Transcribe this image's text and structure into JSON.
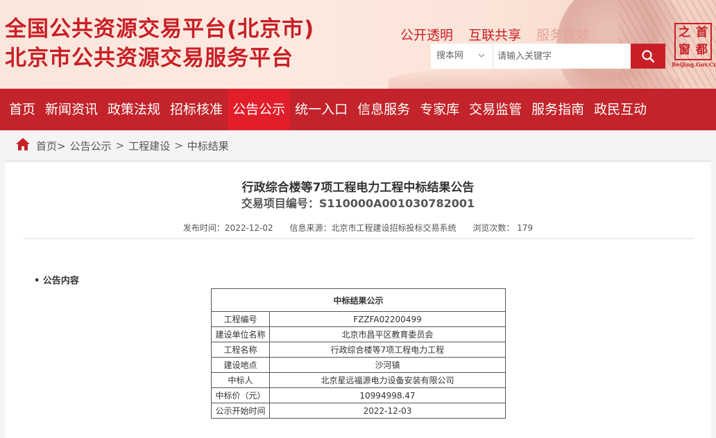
{
  "header": {
    "title_line1": "全国公共资源交易平台(北京市)",
    "title_line2": "北京市公共资源交易服务平台",
    "slogans": [
      "公开透明",
      "互联共享",
      "服务高效"
    ],
    "search": {
      "scope_selected": "搜本网",
      "placeholder": "请输入关键字",
      "button_icon": "search-icon"
    },
    "logo": {
      "chars": [
        "首",
        "都",
        "之",
        "窗"
      ],
      "caption": "Beijing.Gov.Cn"
    },
    "colors": {
      "brand_red": "#c81f26",
      "nav_bg": "#c3232a",
      "nav_active": "#e21e2a"
    }
  },
  "nav": {
    "items": [
      "首页",
      "新闻资讯",
      "政策法规",
      "招标核准",
      "公告公示",
      "统一入口",
      "信息服务",
      "专家库",
      "交易监管",
      "服务指南",
      "政民互动"
    ],
    "active": "公告公示"
  },
  "breadcrumb": {
    "home_icon": "home-icon",
    "home": "首页>",
    "items": [
      "公告公示",
      "工程建设",
      "中标结果"
    ],
    "separator": ">"
  },
  "article": {
    "title": "行政综合楼等7项工程电力工程中标结果公告",
    "code": "交易项目编号：S110000A001030782001",
    "publish_time": "发布时间：2022-12-02",
    "source": "信息来源：北京市工程建设招标投标交易系统",
    "views": "浏览次数：  179",
    "section_label": "• 公告内容",
    "table": {
      "heading": "中标结果公示",
      "rows": [
        {
          "key": "工程编号",
          "value": "FZZFA02200499"
        },
        {
          "key": "建设单位名称",
          "value": "北京市昌平区教育委员会"
        },
        {
          "key": "工程名称",
          "value": "行政综合楼等7项工程电力工程"
        },
        {
          "key": "建设地点",
          "value": "沙河镇"
        },
        {
          "key": "中标人",
          "value": "北京星远福源电力设备安装有限公司"
        },
        {
          "key": "中标价（元）",
          "value": "10994998.47"
        },
        {
          "key": "公示开始时间",
          "value": "2022-12-03"
        }
      ]
    }
  }
}
